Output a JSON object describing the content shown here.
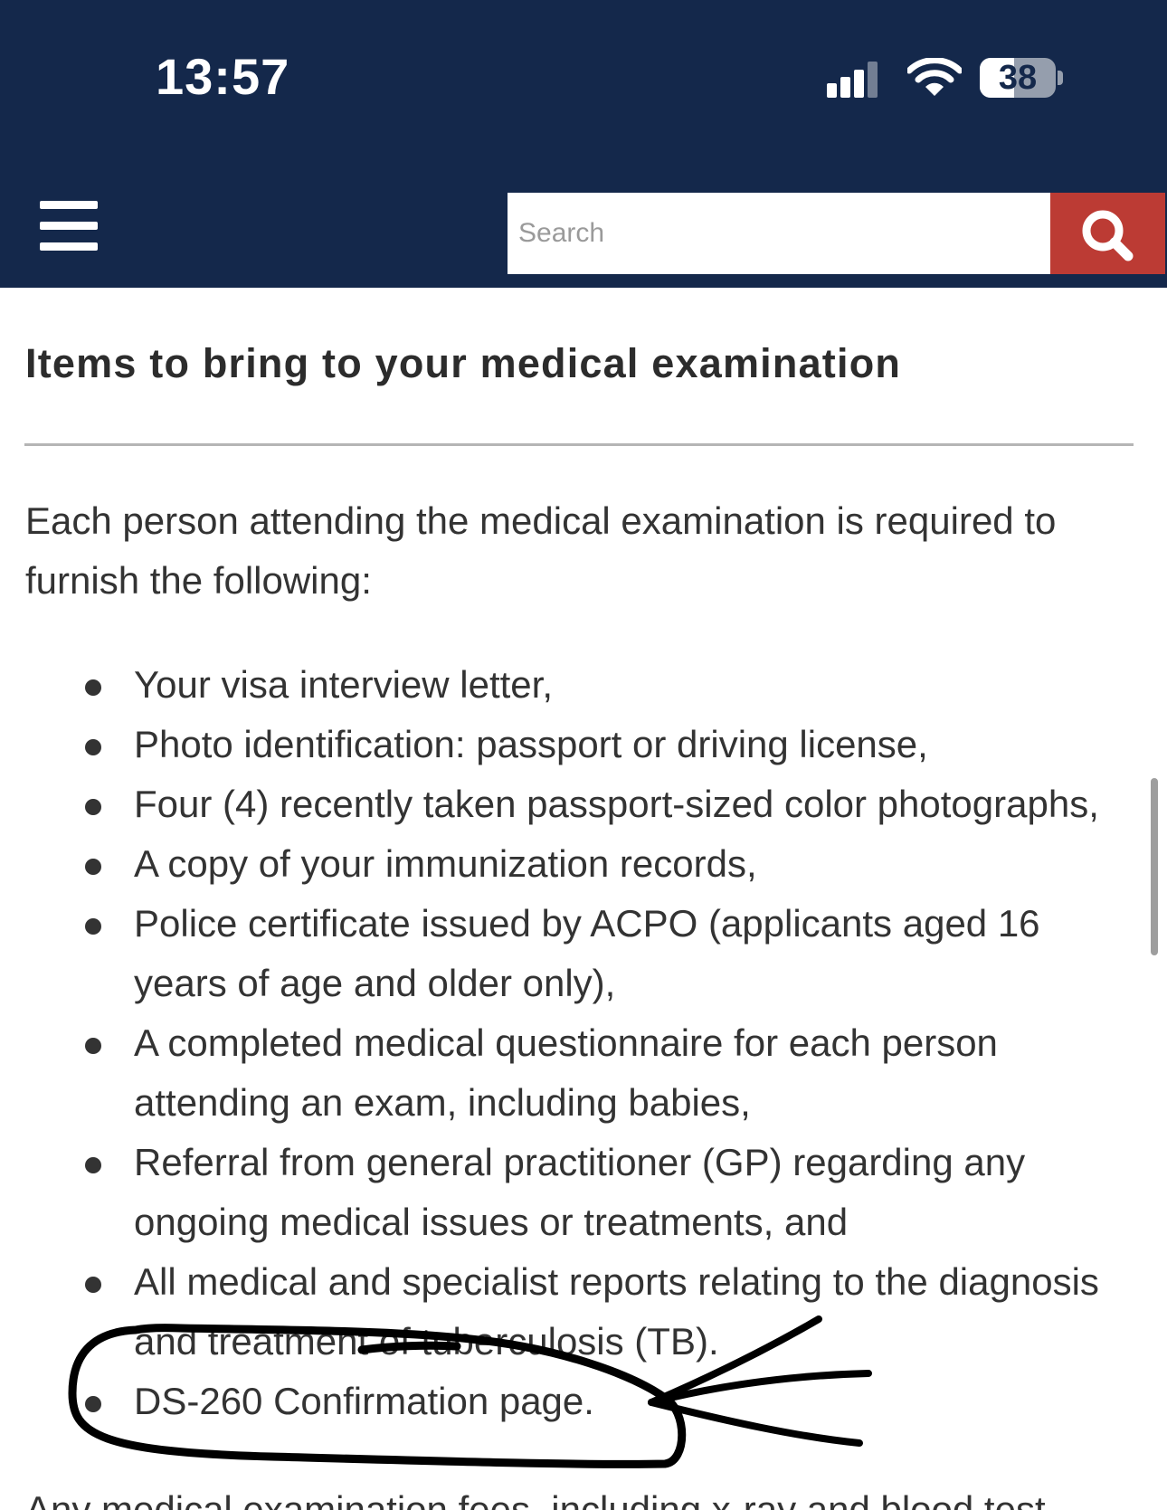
{
  "status_bar": {
    "time": "13:57",
    "battery": "38"
  },
  "header": {
    "search_placeholder": "Search"
  },
  "article": {
    "heading": "Items to bring to your medical examination",
    "intro": "Each person attending the medical examination is required to furnish the following:",
    "items": [
      "Your visa interview letter,",
      "Photo identification: passport or driving license,",
      "Four (4) recently taken passport-sized color photographs,",
      "A copy of your immunization records,",
      "Police certificate issued by ACPO (applicants aged 16 years of age and older only),",
      "A completed medical questionnaire for each person attending an exam, including babies,",
      "Referral from general practitioner (GP) regarding any ongoing medical issues or treatments, and",
      "All medical and specialist reports relating to the diagnosis and treatment of tuberculosis (TB).",
      "DS-260 Confirmation page."
    ],
    "partial_next": "Any medical examination fees, including x-ray and blood test"
  },
  "colors": {
    "header_bg": "#14284b",
    "search_button_bg": "#bc3b34",
    "text": "#333333"
  },
  "icons": {
    "menu": "hamburger-icon",
    "search": "magnifier-icon",
    "signal": "cellular-signal-icon",
    "wifi": "wifi-icon",
    "battery": "battery-icon"
  }
}
